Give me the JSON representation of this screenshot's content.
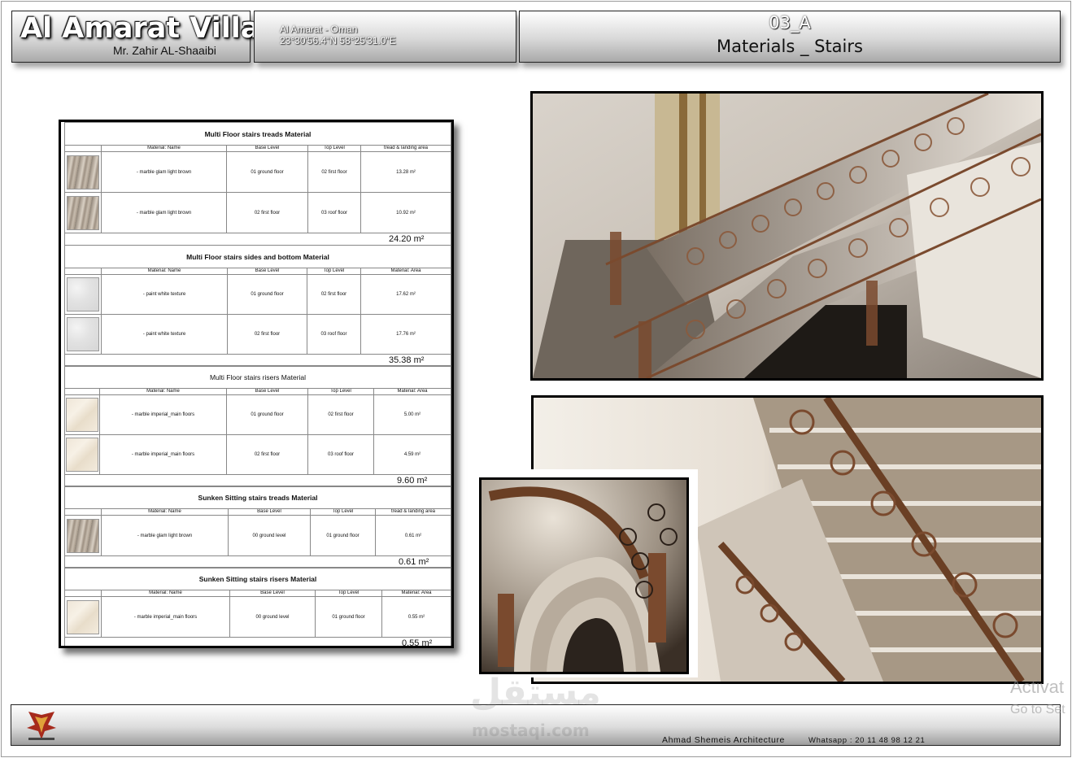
{
  "header": {
    "project_title": "Al Amarat Villa",
    "client": "Mr. Zahir AL-Shaaibi",
    "location": "Al Amarat - Oman",
    "coordinates": "23°30'56.4\"N 58°25'31.0\"E",
    "sheet_number": "03_A",
    "sheet_title": "Materials _ Stairs"
  },
  "schedules": [
    {
      "title": "Multi Floor stairs treads Material",
      "columns": [
        "Material: Name",
        "Base Level",
        "Top Level",
        "tread & landing area"
      ],
      "rows": [
        {
          "swatch": "marble",
          "name": "- marble glam light brown",
          "base": "01 ground floor",
          "top": "02 first floor",
          "area": "13.28 m²"
        },
        {
          "swatch": "marble",
          "name": "- marble glam light brown",
          "base": "02 first floor",
          "top": "03 roof floor",
          "area": "10.92 m²"
        }
      ],
      "total": "24.20 m²"
    },
    {
      "title": "Multi Floor stairs sides and bottom Material",
      "columns": [
        "Material: Name",
        "Base Level",
        "Top Level",
        "Material: Area"
      ],
      "rows": [
        {
          "swatch": "paint",
          "name": "- paint white texture",
          "base": "01 ground floor",
          "top": "02 first floor",
          "area": "17.62 m²"
        },
        {
          "swatch": "paint",
          "name": "- paint white texture",
          "base": "02 first floor",
          "top": "03 roof floor",
          "area": "17.76 m²"
        }
      ],
      "total": "35.38 m²"
    },
    {
      "title": "Multi Floor stairs risers Material",
      "columns": [
        "Material: Name",
        "Base Level",
        "Top Level",
        "Material: Area"
      ],
      "rows": [
        {
          "swatch": "imperial",
          "name": "- marble imperial_main floors",
          "base": "01 ground floor",
          "top": "02 first floor",
          "area": "5.00 m²"
        },
        {
          "swatch": "imperial",
          "name": "- marble imperial_main floors",
          "base": "02 first floor",
          "top": "03 roof floor",
          "area": "4.59 m²"
        }
      ],
      "total": "9.60 m²"
    },
    {
      "title": "Sunken Sitting stairs treads Material",
      "columns": [
        "Material: Name",
        "Base Level",
        "Top Level",
        "tread & landing area"
      ],
      "rows": [
        {
          "swatch": "marble",
          "name": "- marble glam light brown",
          "base": "00 ground level",
          "top": "01 ground floor",
          "area": "0.61 m²"
        }
      ],
      "total": "0.61 m²"
    },
    {
      "title": "Sunken Sitting stairs risers Material",
      "columns": [
        "Material: Name",
        "Base Level",
        "Top Level",
        "Material: Area"
      ],
      "rows": [
        {
          "swatch": "imperial",
          "name": "- marble imperial_main floors",
          "base": "00 ground level",
          "top": "01 ground floor",
          "area": "0.55 m²"
        }
      ],
      "total": "0.55 m²"
    }
  ],
  "footer": {
    "studio": "Ahmad Shemeis Architecture",
    "whatsapp": "Whatsapp :   20 11 48 98 12 21"
  },
  "watermark": {
    "arabic": "مستقل",
    "latin": "mostaqi.com"
  },
  "os_overlay": {
    "line1": "Activat",
    "line2": "Go to Set"
  },
  "colors": {
    "wood": "#7a4a2e",
    "railing": "#8b5a3c",
    "marble": "#b8ada0",
    "wall": "#ece7e0"
  }
}
